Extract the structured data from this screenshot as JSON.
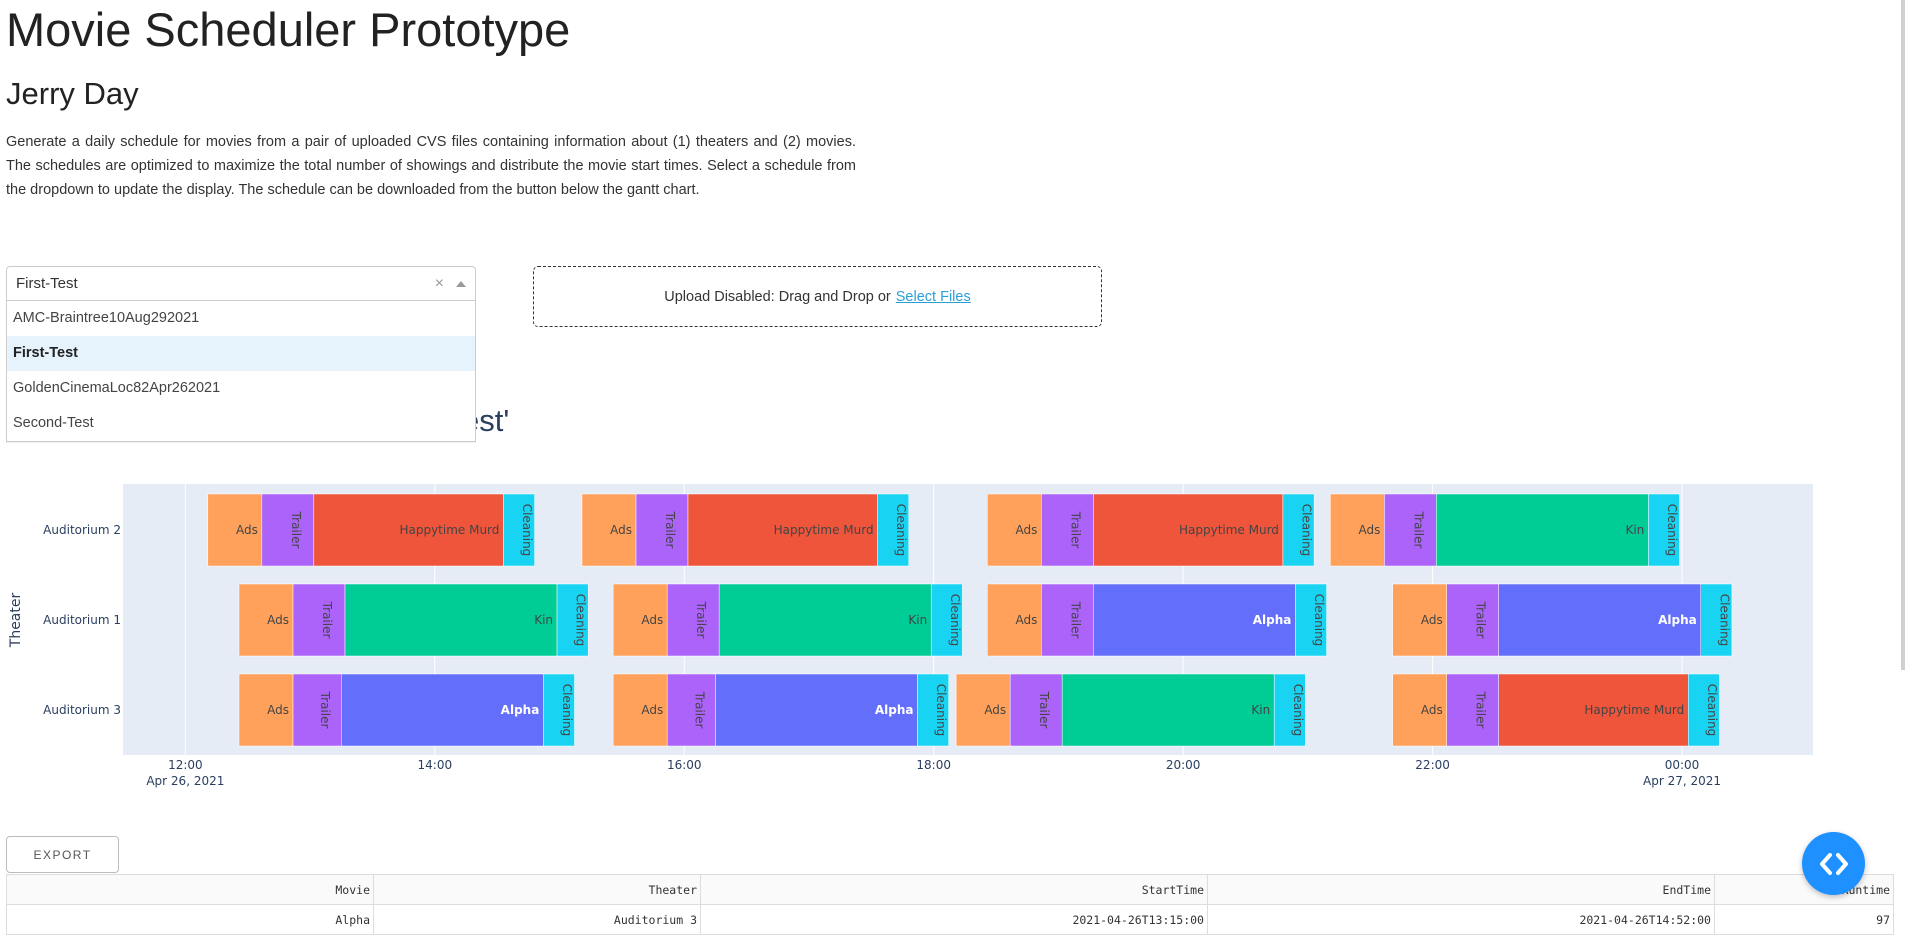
{
  "header": {
    "title": "Movie Scheduler Prototype",
    "author": "Jerry Day",
    "description": "Generate a daily schedule for movies from a pair of uploaded CVS files containing information about (1) theaters and (2) movies. The schedules are optimized to maximize the total number of showings and distribute the movie start times. Select a schedule from the dropdown to update the display. The schedule can be downloaded from the button below the gantt chart."
  },
  "dropdown": {
    "value": "First-Test",
    "clear_glyph": "×",
    "options": [
      "AMC-Braintree10Aug292021",
      "First-Test",
      "GoldenCinemaLoc82Apr262021",
      "Second-Test"
    ],
    "selected_index": 1
  },
  "upload": {
    "text": "Upload Disabled: Drag and Drop or",
    "link": "Select Files"
  },
  "chart_heading": "'First-Test'",
  "chart_data": {
    "type": "gantt",
    "ylabel": "Theater",
    "rows": [
      "Auditorium 2",
      "Auditorium 1",
      "Auditorium 3"
    ],
    "x_ticks": [
      {
        "time": "12:00",
        "date": "Apr 26, 2021",
        "hour": 12
      },
      {
        "time": "14:00",
        "date": "",
        "hour": 14
      },
      {
        "time": "16:00",
        "date": "",
        "hour": 16
      },
      {
        "time": "18:00",
        "date": "",
        "hour": 18
      },
      {
        "time": "20:00",
        "date": "",
        "hour": 20
      },
      {
        "time": "22:00",
        "date": "",
        "hour": 22
      },
      {
        "time": "00:00",
        "date": "Apr 27, 2021",
        "hour": 24
      }
    ],
    "x_range_hours": [
      11.5,
      25.05
    ],
    "colors": {
      "Ads": "#ffa15a",
      "Trailer": "#ab63fa",
      "Happytime Murd": "#ef553b",
      "Kin": "#00cc96",
      "Alpha": "#636efa",
      "Cleaning": "#19d3f3"
    },
    "showings": [
      {
        "row": "Auditorium 2",
        "ads": 12.18,
        "movie": "Happytime Murd",
        "start": 13.03,
        "end": 14.55
      },
      {
        "row": "Auditorium 2",
        "ads": 15.18,
        "movie": "Happytime Murd",
        "start": 16.03,
        "end": 17.55
      },
      {
        "row": "Auditorium 2",
        "ads": 18.43,
        "movie": "Happytime Murd",
        "start": 19.28,
        "end": 20.8
      },
      {
        "row": "Auditorium 2",
        "ads": 21.18,
        "movie": "Kin",
        "start": 22.03,
        "end": 23.73
      },
      {
        "row": "Auditorium 1",
        "ads": 12.43,
        "movie": "Kin",
        "start": 13.28,
        "end": 14.98
      },
      {
        "row": "Auditorium 1",
        "ads": 15.43,
        "movie": "Kin",
        "start": 16.28,
        "end": 17.98
      },
      {
        "row": "Auditorium 1",
        "ads": 18.43,
        "movie": "Alpha",
        "start": 19.28,
        "end": 20.9
      },
      {
        "row": "Auditorium 1",
        "ads": 21.68,
        "movie": "Alpha",
        "start": 22.53,
        "end": 24.15
      },
      {
        "row": "Auditorium 3",
        "ads": 12.43,
        "movie": "Alpha",
        "start": 13.25,
        "end": 14.87
      },
      {
        "row": "Auditorium 3",
        "ads": 15.43,
        "movie": "Alpha",
        "start": 16.25,
        "end": 17.87
      },
      {
        "row": "Auditorium 3",
        "ads": 18.18,
        "movie": "Kin",
        "start": 19.03,
        "end": 20.73
      },
      {
        "row": "Auditorium 3",
        "ads": 21.68,
        "movie": "Happytime Murd",
        "start": 22.53,
        "end": 24.05
      }
    ]
  },
  "export_label": "EXPORT",
  "table": {
    "headers": [
      "Movie",
      "Theater",
      "StartTime",
      "EndTime",
      "Runtime"
    ],
    "rows": [
      [
        "Alpha",
        "Auditorium 3",
        "2021-04-26T13:15:00",
        "2021-04-26T14:52:00",
        "97"
      ]
    ]
  },
  "fab_icon": "code-icon"
}
